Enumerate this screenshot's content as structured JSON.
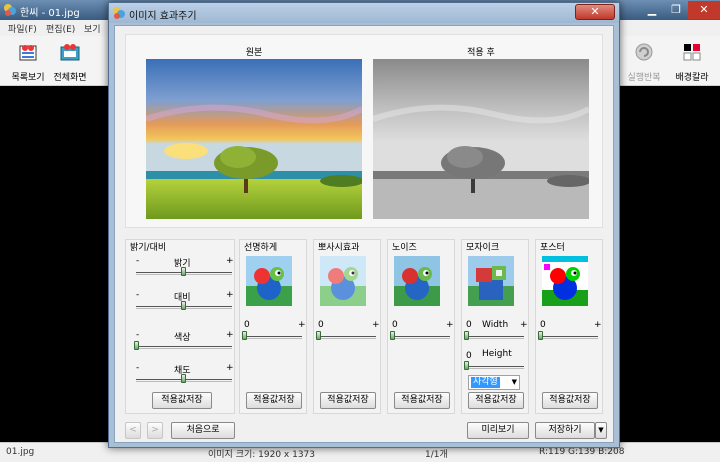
{
  "main_window": {
    "title": "한씨 - 01.jpg",
    "window_buttons": [
      "▁",
      "❐",
      "✕"
    ],
    "menu": [
      "파일(F)",
      "편집(E)",
      "보기"
    ],
    "toolbar": {
      "list_view": "목록보기",
      "fullscreen": "전체화면",
      "undo": "실행반복",
      "bg_color": "배경칼라"
    },
    "status": {
      "filename": "01.jpg",
      "image_size": "이미지 크기: 1920 x 1373",
      "page": "1/1개",
      "color_info": "R:119 G:139 B:208"
    }
  },
  "dialog": {
    "title": "이미지 효과주기",
    "preview": {
      "original_label": "원본",
      "applied_label": "적용 후"
    },
    "brightness_group": {
      "title": "밝기/대비",
      "sliders": [
        {
          "label": "밝기",
          "min": "-",
          "max": "+",
          "value": 0.5
        },
        {
          "label": "대비",
          "min": "-",
          "max": "+",
          "value": 0.5
        },
        {
          "label": "색상",
          "min": "-",
          "max": "+",
          "value": 0.0
        },
        {
          "label": "채도",
          "min": "-",
          "max": "+",
          "value": 0.5
        }
      ],
      "save_label": "적용값저장"
    },
    "effects": [
      {
        "title": "선명하게",
        "slider_min": "0",
        "slider_max": "+",
        "value": 0.0,
        "save_label": "적용값저장"
      },
      {
        "title": "뽀사시효과",
        "slider_min": "0",
        "slider_max": "+",
        "value": 0.0,
        "save_label": "적용값저장"
      },
      {
        "title": "노이즈",
        "slider_min": "0",
        "slider_max": "+",
        "value": 0.0,
        "save_label": "적용값저장"
      },
      {
        "title": "모자이크",
        "width_min": "0",
        "width_label": "Width",
        "width_max": "+",
        "height_min": "0",
        "height_label": "Height",
        "shape_value": "사각형",
        "save_label": "적용값저장"
      },
      {
        "title": "포스터",
        "slider_min": "0",
        "slider_max": "+",
        "value": 0.0,
        "save_label": "적용값저장"
      }
    ],
    "footer": {
      "prev": "<",
      "next": ">",
      "reset": "처음으로",
      "preview": "미리보기",
      "save": "저장하기",
      "save_menu_arrow": "▼"
    }
  }
}
